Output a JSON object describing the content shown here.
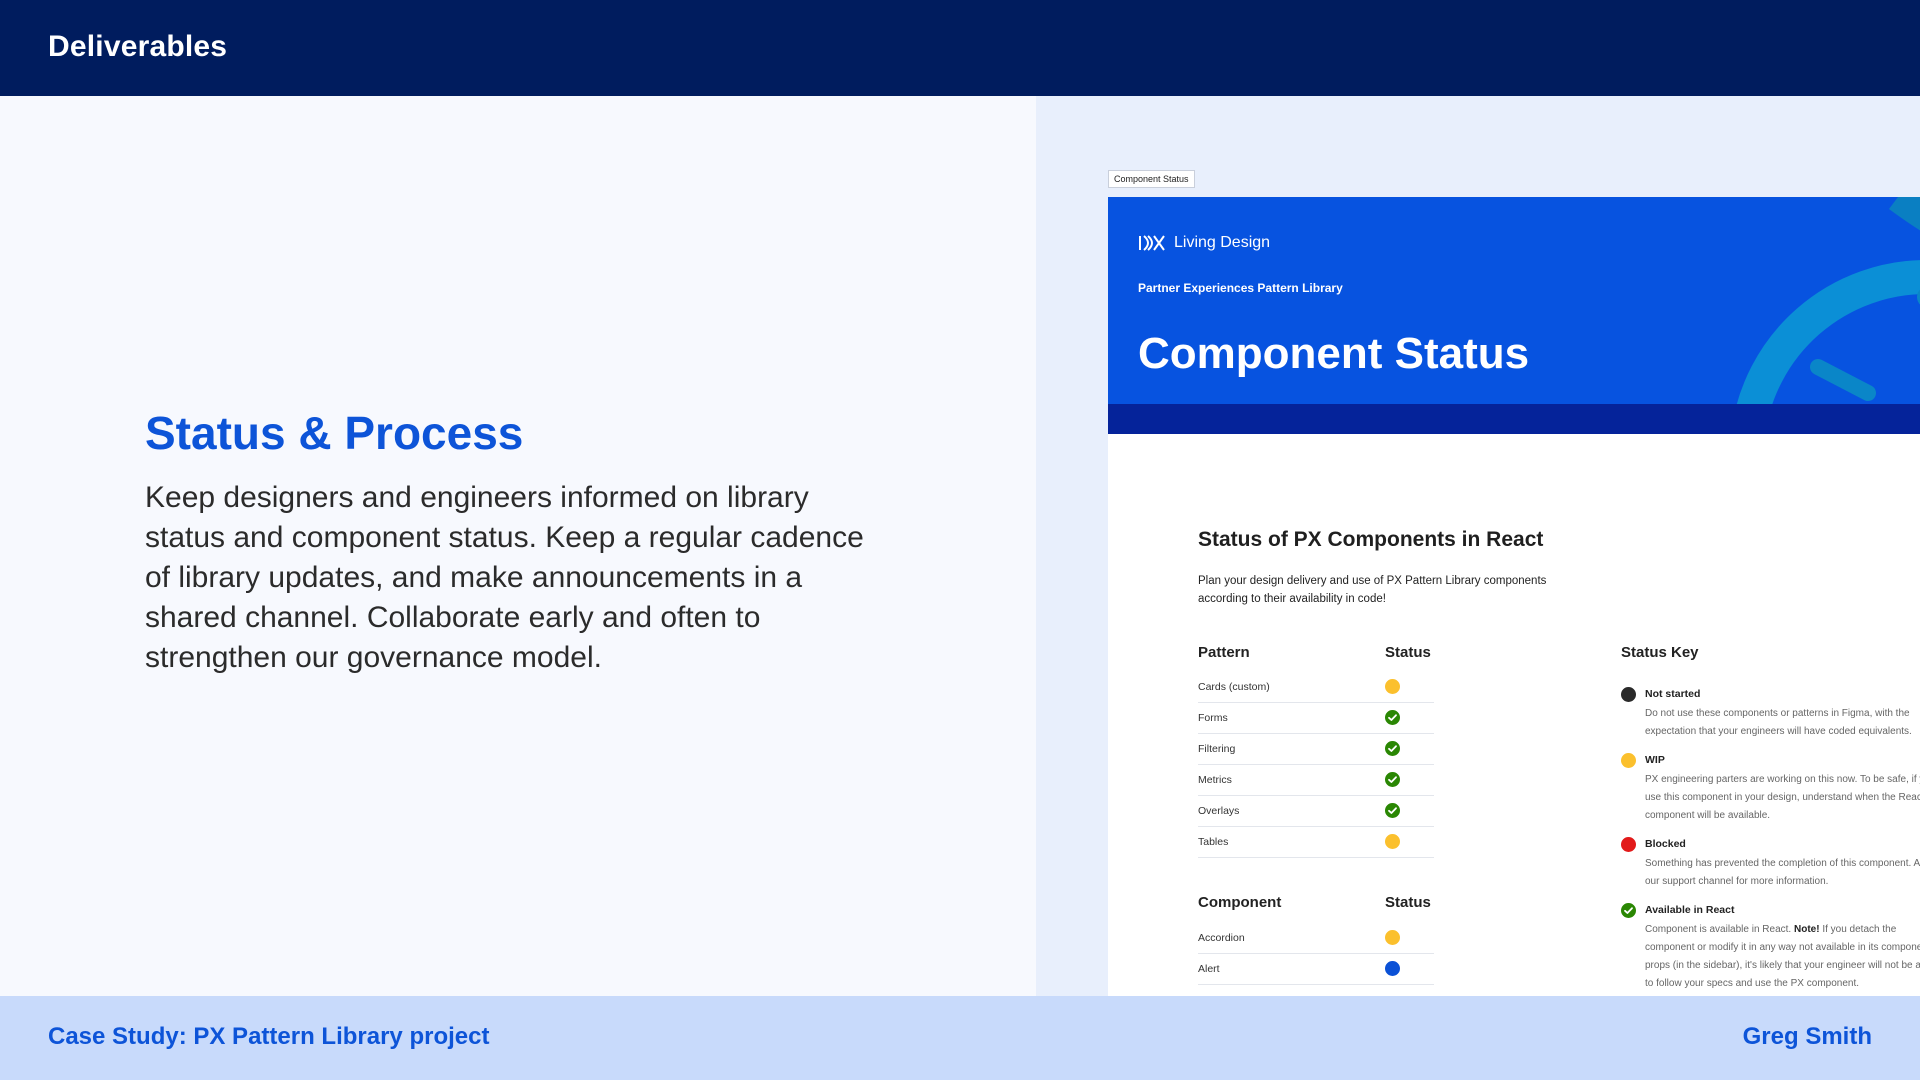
{
  "header": {
    "title": "Deliverables"
  },
  "left": {
    "heading": "Status & Process",
    "body": "Keep designers and engineers informed on library status and component status. Keep a regular cadence of library updates, and make announcements in a shared channel. Collaborate early and often to strengthen our governance model."
  },
  "preview": {
    "frame_label": "Component Status",
    "logo_text": "Living Design",
    "subtitle": "Partner Experiences Pattern Library",
    "title": "Component Status",
    "section_title": "Status of PX Components in React",
    "intro": "Plan your design delivery and use of PX Pattern Library components according to their availability in code!",
    "patterns_header": "Pattern",
    "status_header": "Status",
    "patterns": [
      {
        "name": "Cards (custom)",
        "status": "wip"
      },
      {
        "name": "Forms",
        "status": "available"
      },
      {
        "name": "Filtering",
        "status": "available"
      },
      {
        "name": "Metrics",
        "status": "available"
      },
      {
        "name": "Overlays",
        "status": "available"
      },
      {
        "name": "Tables",
        "status": "wip"
      }
    ],
    "components_header": "Component",
    "components": [
      {
        "name": "Accordion",
        "status": "wip"
      },
      {
        "name": "Alert",
        "status": "blue"
      }
    ],
    "key_header": "Status Key",
    "key": [
      {
        "status": "not-started",
        "title": "Not started",
        "desc": "Do not use these components or patterns in Figma, with the expectation that your engineers will have coded equivalents."
      },
      {
        "status": "wip",
        "title": "WIP",
        "desc": "PX engineering parters are working on this now. To be safe, if you use this component in your design, understand when the React component will be available."
      },
      {
        "status": "blocked",
        "title": "Blocked",
        "desc": "Something has prevented the completion of this component. Ask in our support channel for more information."
      },
      {
        "status": "available",
        "title": "Available in React",
        "desc_note": "Note!",
        "desc_before": "Component is available in React. ",
        "desc_after": " If you detach the component or modify it in any way not available in its component props (in the sidebar), it's likely that your engineer will not be able to follow your specs and use the PX component."
      }
    ]
  },
  "colors": {
    "not-started": "#2a2a2a",
    "wip": "#fbc02d",
    "blocked": "#e21a1a",
    "available": "#2a8703",
    "blue": "#0b51d6"
  },
  "footer": {
    "left": "Case Study: PX Pattern Library project",
    "right": "Greg Smith"
  }
}
